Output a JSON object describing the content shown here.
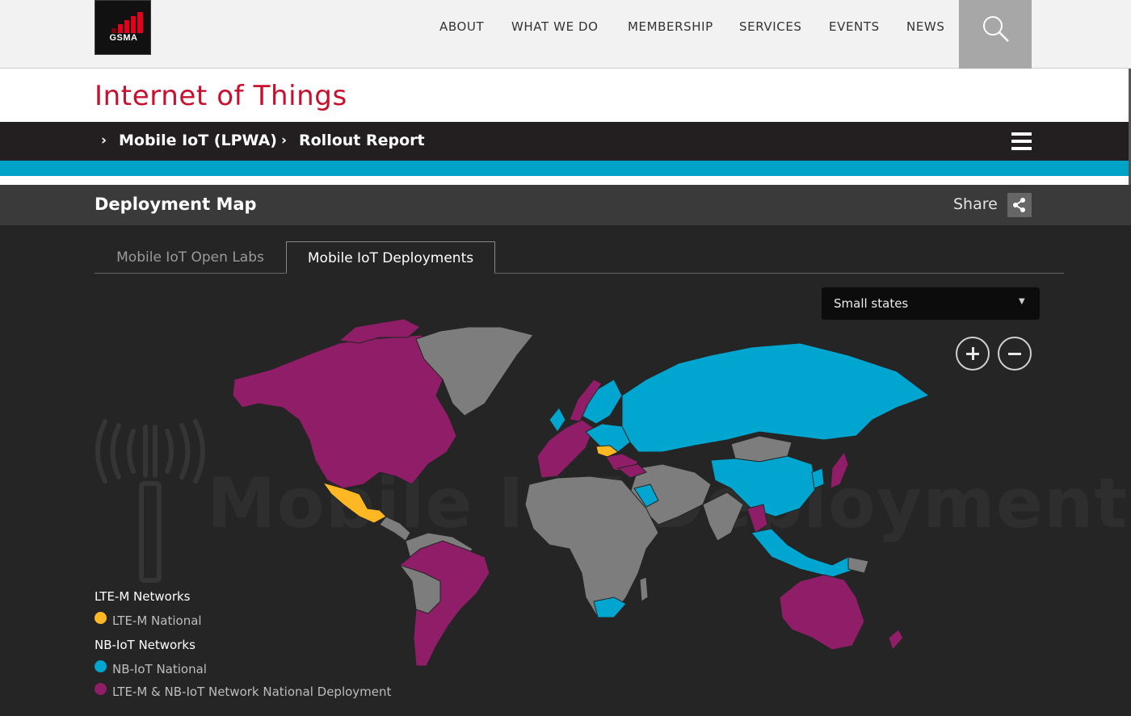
{
  "brand": {
    "logo_text": "GSMA"
  },
  "nav": {
    "items": [
      "ABOUT",
      "WHAT WE DO",
      "MEMBERSHIP",
      "SERVICES",
      "EVENTS",
      "NEWS"
    ]
  },
  "page": {
    "title": "Internet of Things"
  },
  "breadcrumb": [
    "Mobile IoT (LPWA)",
    "Rollout Report"
  ],
  "section": {
    "title": "Deployment Map",
    "share_label": "Share"
  },
  "tabs": [
    {
      "label": "Mobile IoT Open Labs",
      "active": false
    },
    {
      "label": "Mobile IoT Deployments",
      "active": true
    }
  ],
  "filter": {
    "selected": "Small states"
  },
  "watermark": "Mobile IoT Deployments",
  "legend": {
    "lte_m_heading": "LTE-M Networks",
    "lte_m_national": "LTE-M National",
    "nb_iot_heading": "NB-IoT Networks",
    "nb_iot_national": "NB-IoT National",
    "both_national": "LTE-M & NB-IoT Network National Deployment"
  },
  "colors": {
    "lte_m": "#ffb824",
    "nb_iot": "#00a6d0",
    "both": "#8f1d67",
    "none": "#7d7d7d",
    "accent_red": "#c8102e",
    "accent_blue": "#00a3c7"
  }
}
